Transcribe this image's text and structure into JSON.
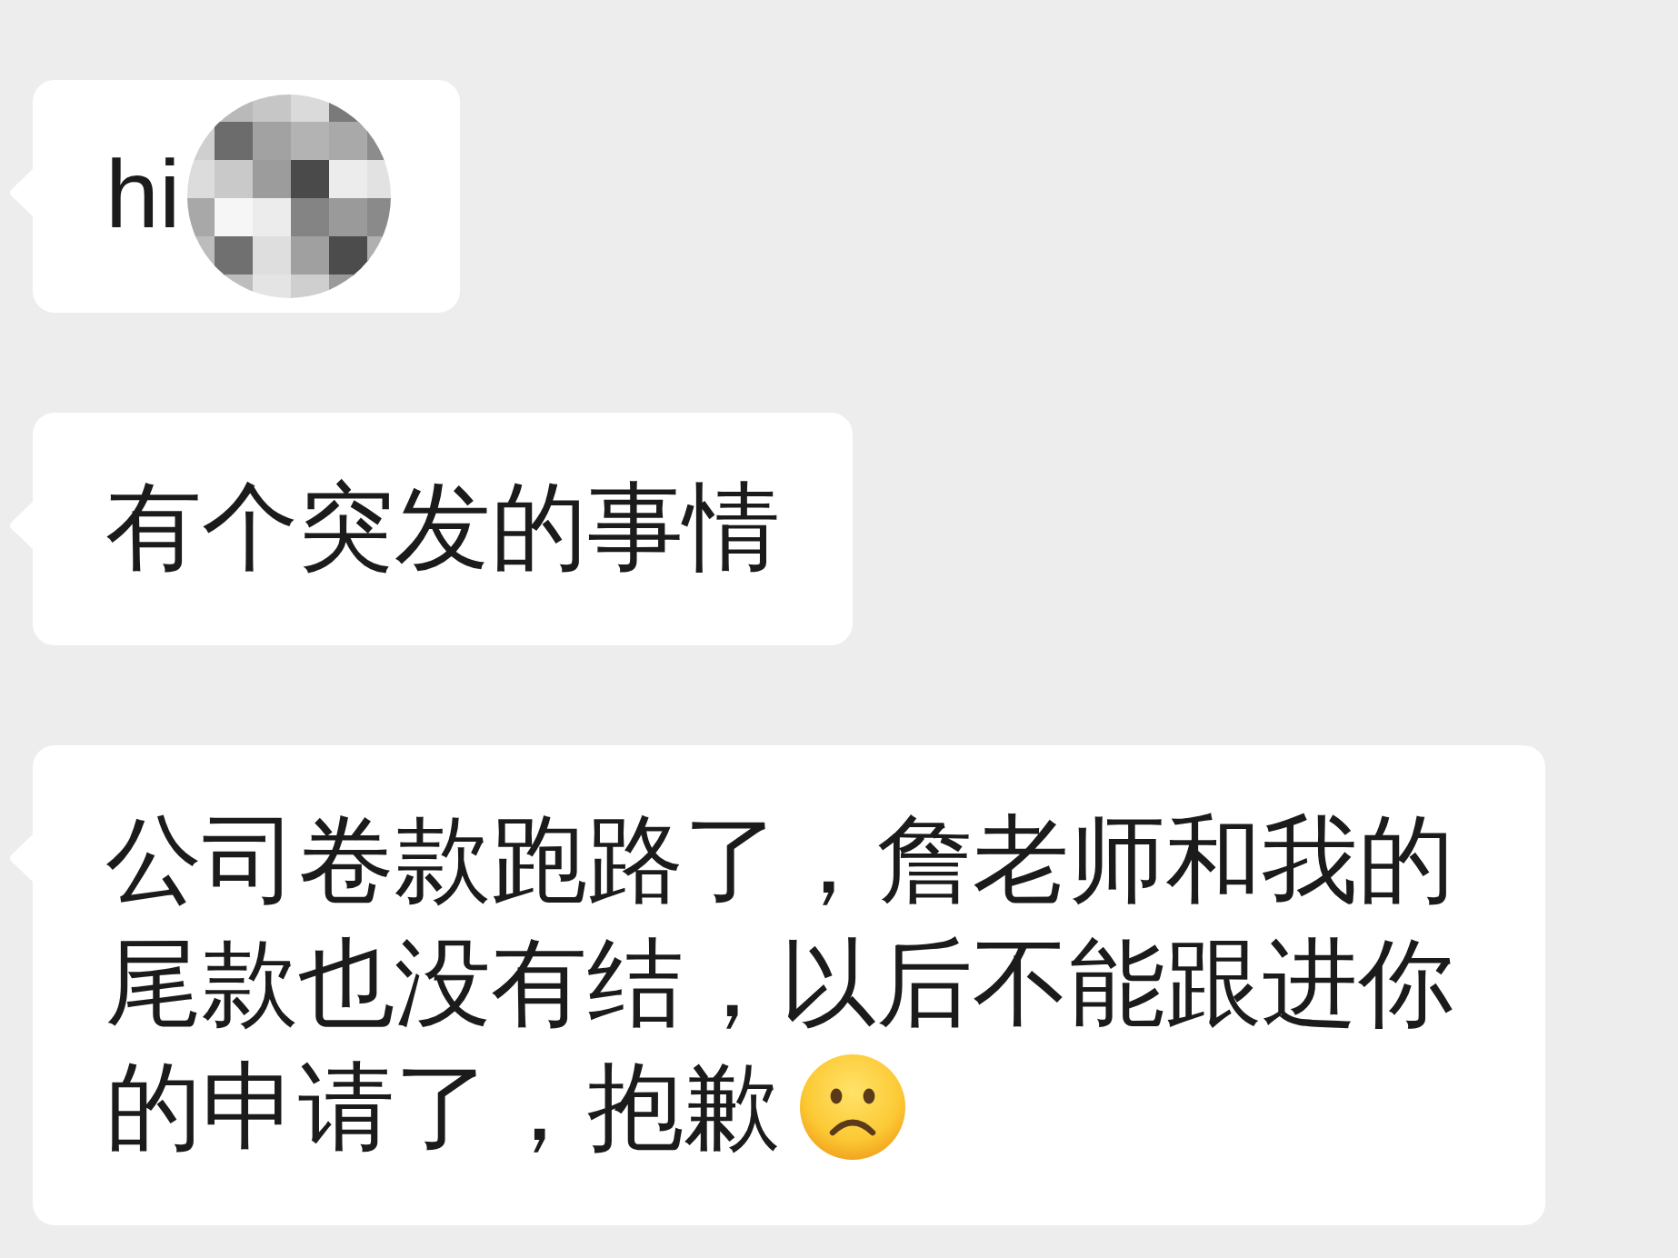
{
  "messages": [
    {
      "kind": "redacted",
      "text": "hi"
    },
    {
      "kind": "plain",
      "text": "有个突发的事情"
    },
    {
      "kind": "emoji",
      "text": "公司卷款跑路了，詹老师和我的尾款也没有结，以后不能跟进你的申请了，抱歉"
    }
  ]
}
